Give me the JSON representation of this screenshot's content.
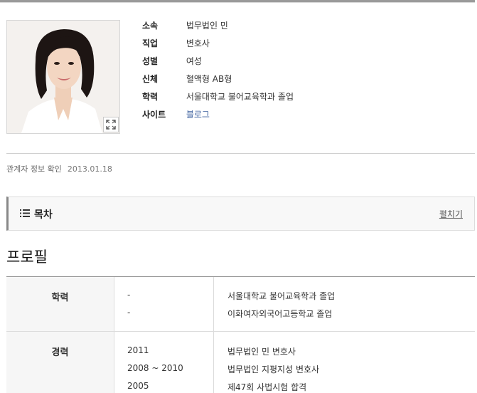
{
  "profile": {
    "info": [
      {
        "label": "소속",
        "value": "법무법인 민",
        "link": false
      },
      {
        "label": "직업",
        "value": "변호사",
        "link": false
      },
      {
        "label": "성별",
        "value": "여성",
        "link": false
      },
      {
        "label": "신체",
        "value": "혈액형 AB형",
        "link": false
      },
      {
        "label": "학력",
        "value": "서울대학교 불어교육학과 졸업",
        "link": false
      },
      {
        "label": "사이트",
        "value": "블로그",
        "link": true
      }
    ],
    "confirm": {
      "label": "관계자 정보 확인",
      "date": "2013.01.18"
    },
    "photo_expand_icon": "expand-icon"
  },
  "toc": {
    "title": "목차",
    "toggle": "펼치기",
    "icon": "list-icon"
  },
  "section": {
    "heading": "프로필"
  },
  "table": [
    {
      "category": "학력",
      "entries": [
        {
          "period": "-",
          "detail": "서울대학교 불어교육학과 졸업"
        },
        {
          "period": "-",
          "detail": "이화여자외국어고등학교 졸업"
        }
      ]
    },
    {
      "category": "경력",
      "entries": [
        {
          "period": "2011",
          "detail": "법무법인 민 변호사"
        },
        {
          "period": "2008 ~ 2010",
          "detail": "법무법인 지평지성 변호사"
        },
        {
          "period": "2005",
          "detail": "제47회 사법시험 합격"
        }
      ]
    }
  ],
  "colors": {
    "link": "#3a5e9c",
    "accent_bar": "#888888",
    "label_bg": "#f6f6f6"
  }
}
